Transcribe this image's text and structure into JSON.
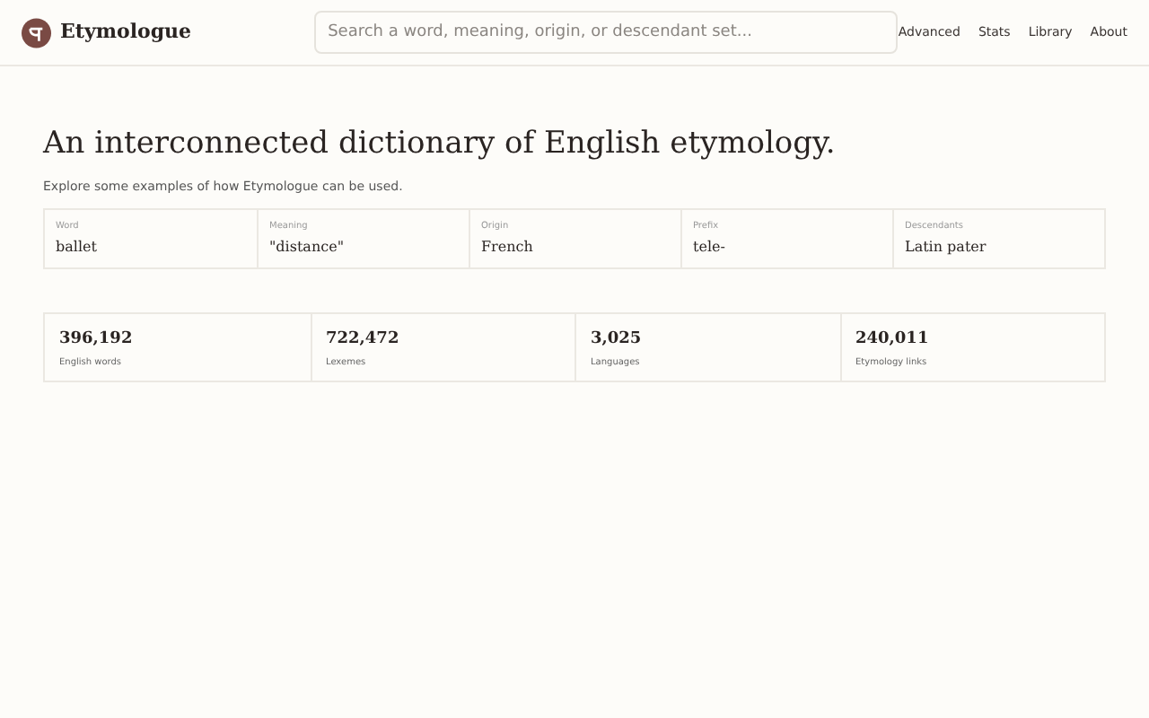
{
  "header": {
    "brand": "Etymologue",
    "search": {
      "placeholder": "Search a word, meaning, origin, or descendant set..."
    },
    "nav": [
      "Advanced",
      "Stats",
      "Library",
      "About"
    ]
  },
  "hero": {
    "title": "An interconnected dictionary of English etymology.",
    "subtitle": "Explore some examples of how Etymologue can be used."
  },
  "examples": [
    {
      "label": "Word",
      "value": "ballet"
    },
    {
      "label": "Meaning",
      "value": "\"distance\""
    },
    {
      "label": "Origin",
      "value": "French"
    },
    {
      "label": "Prefix",
      "value": "tele-"
    },
    {
      "label": "Descendants",
      "value": "Latin pater"
    }
  ],
  "stats": [
    {
      "value": "396,192",
      "label": "English words"
    },
    {
      "value": "722,472",
      "label": "Lexemes"
    },
    {
      "value": "3,025",
      "label": "Languages"
    },
    {
      "value": "240,011",
      "label": "Etymology links"
    }
  ]
}
